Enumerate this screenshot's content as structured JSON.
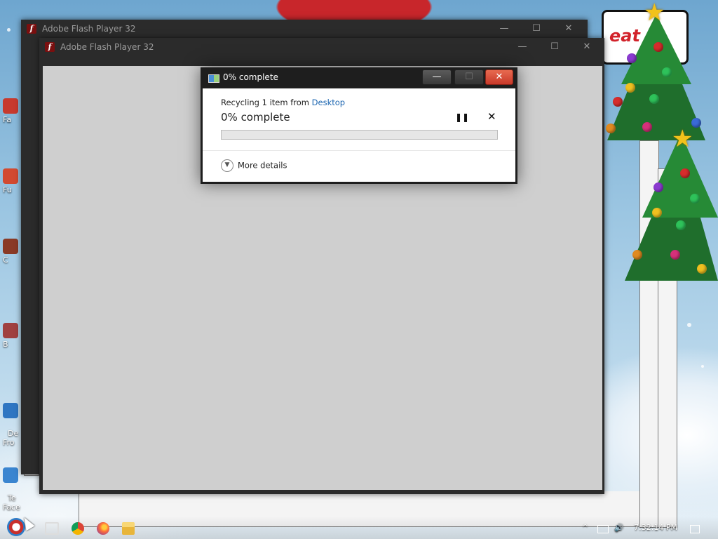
{
  "background_windows": [
    {
      "title": "Adobe Flash Player 32",
      "app_icon": "flash-icon",
      "controls": {
        "minimize": "—",
        "maximize": "☐",
        "close": "✕"
      }
    },
    {
      "title": "Adobe Flash Player 32",
      "app_icon": "flash-icon",
      "controls": {
        "minimize": "—",
        "maximize": "☐",
        "close": "✕"
      }
    }
  ],
  "banner_text": "eat it",
  "dialog": {
    "title": "0% complete",
    "app_icon": "recycle-progress-icon",
    "controls": {
      "minimize": "—",
      "maximize": "☐",
      "close": "✕"
    },
    "status_prefix": "Recycling 1 item from ",
    "status_location": "Desktop",
    "headline": "0% complete",
    "progress_percent": 0,
    "pause_symbol": "❚❚",
    "cancel_symbol": "✕",
    "more_details_label": "More details",
    "more_details_icon": "chevron-down-icon"
  },
  "desktop_icon_labels": [
    "Fa",
    "Fu",
    "C",
    "B",
    "De\nFro",
    "Te\nFace"
  ],
  "taskbar": {
    "items": [
      "start-button",
      "task-view-icon",
      "chrome-icon",
      "firefox-icon",
      "file-explorer-icon"
    ],
    "tray": {
      "chevron": "^",
      "network": "network-icon",
      "volume": "volume-icon",
      "clock": "7:32:14 PM",
      "notifications": "notification-icon"
    }
  },
  "colors": {
    "titlebar_dark": "#1e1e1e",
    "close_red": "#c8392a",
    "link_blue": "#1b65b0",
    "progress_green": "#06b025",
    "flash_client_gray": "#cfcfcf"
  }
}
